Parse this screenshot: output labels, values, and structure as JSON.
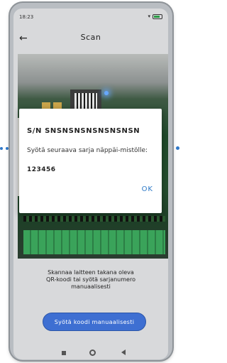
{
  "status_bar": {
    "time": "18:23",
    "battery_color": "#2a9d45"
  },
  "app_bar": {
    "title": "Scan",
    "back_icon": "arrow-left-icon"
  },
  "dialog": {
    "title": "S/N SNSNSNSNSNSNSNSN",
    "message": "Syötä seuraava sarja näppäi-mistölle:",
    "serial": "123456",
    "ok_label": "OK"
  },
  "instructions": {
    "lines": [
      "Skannaa laitteen takana oleva",
      "QR-koodi tai syötä sarjanumero",
      "manuaalisesti"
    ]
  },
  "manual_button": {
    "label": "Syötä koodi manuaalisesti",
    "color": "#3e6fd2"
  },
  "accent_color": "#2e7ac7"
}
